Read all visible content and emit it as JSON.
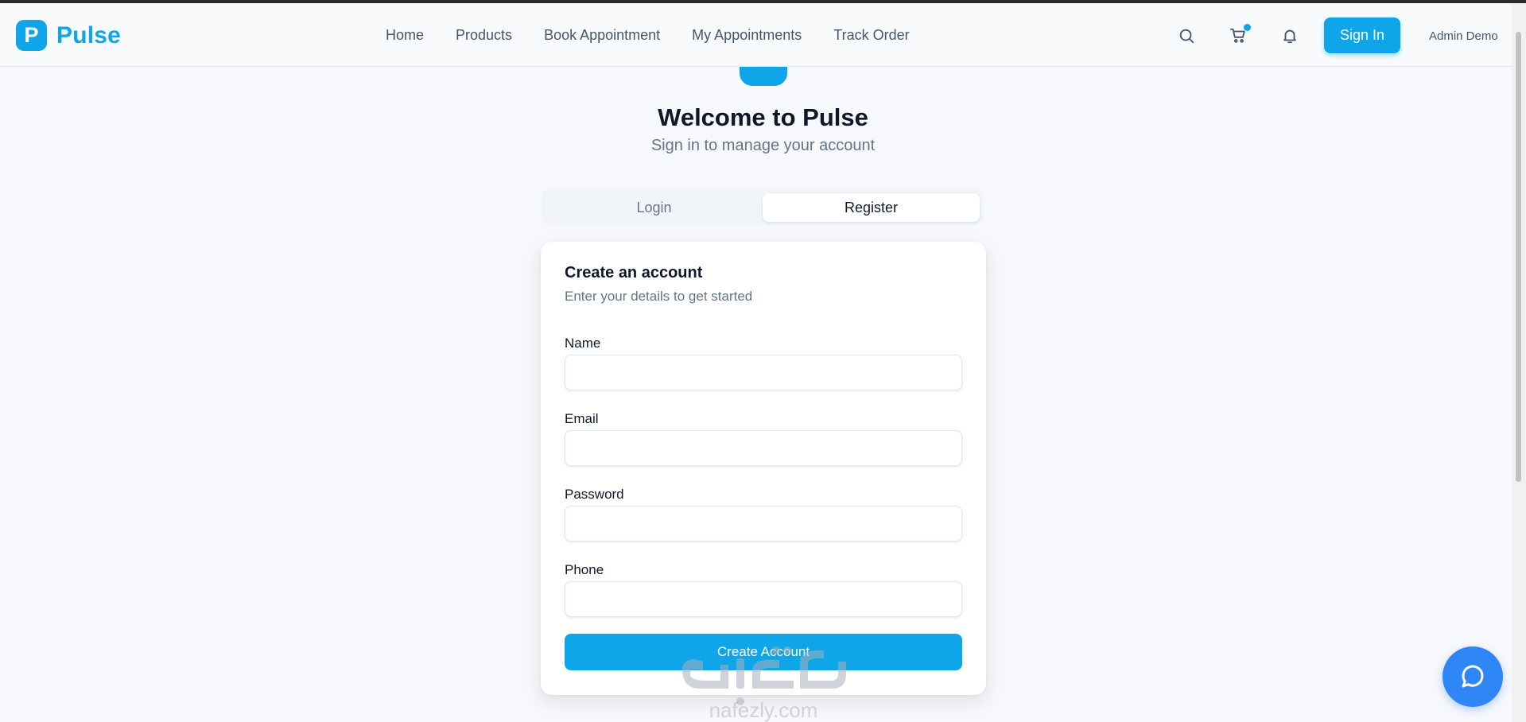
{
  "header": {
    "logo_letter": "P",
    "brand": "Pulse",
    "nav": [
      {
        "label": "Home"
      },
      {
        "label": "Products"
      },
      {
        "label": "Book Appointment"
      },
      {
        "label": "My Appointments"
      },
      {
        "label": "Track Order"
      }
    ],
    "icons": [
      "search-icon",
      "cart-icon",
      "bell-icon"
    ],
    "signin_label": "Sign In",
    "user_name": "Admin Demo"
  },
  "hero": {
    "title": "Welcome to Pulse",
    "subtitle": "Sign in to manage your account"
  },
  "tabs": [
    {
      "label": "Login",
      "active": false
    },
    {
      "label": "Register",
      "active": true
    }
  ],
  "form": {
    "title": "Create an account",
    "subtitle": "Enter your details to get started",
    "fields": [
      {
        "label": "Name",
        "value": ""
      },
      {
        "label": "Email",
        "value": ""
      },
      {
        "label": "Password",
        "value": ""
      },
      {
        "label": "Phone",
        "value": ""
      }
    ],
    "submit_label": "Create Account"
  },
  "chat": {
    "icon": "chat-bubble-icon"
  },
  "watermark": {
    "text": "nafezly.com"
  },
  "colors": {
    "accent": "#0ea5e9",
    "chat": "#2f86f6",
    "page_bg": "#f6f8fb"
  }
}
